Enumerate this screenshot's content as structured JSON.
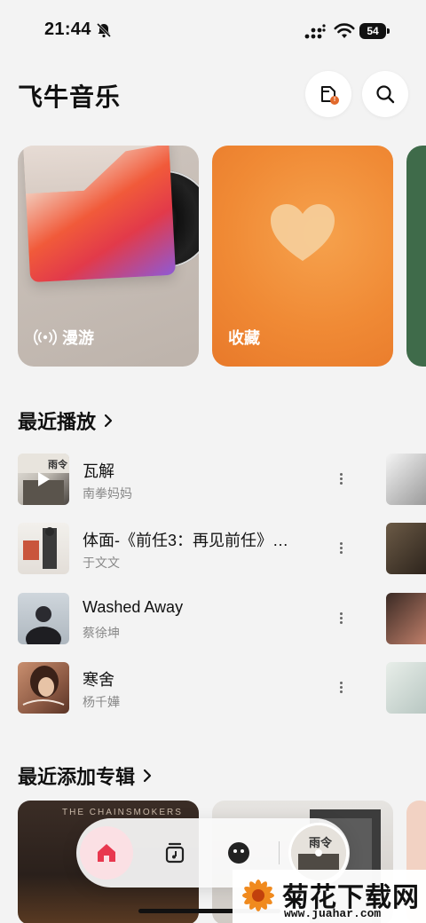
{
  "status_bar": {
    "time": "21:44",
    "battery": "54"
  },
  "header": {
    "title": "飞牛音乐",
    "message_badge": "!"
  },
  "cards": [
    {
      "label": "漫游",
      "icon": "radio-waves-icon"
    },
    {
      "label": "收藏",
      "icon": "heart-icon"
    }
  ],
  "recent": {
    "title": "最近播放",
    "songs": [
      {
        "title": "瓦解",
        "artist": "南拳妈妈",
        "playing": true
      },
      {
        "title": "体面-《前任3：再见前任》…",
        "artist": "于文文"
      },
      {
        "title": "Washed Away",
        "artist": "蔡徐坤"
      },
      {
        "title": "寒舍",
        "artist": "杨千嬅"
      }
    ]
  },
  "albums": {
    "title": "最近添加专辑",
    "items": [
      {
        "caption": "THE CHAINSMOKERS"
      },
      {
        "caption": ""
      }
    ]
  },
  "nav": {
    "items": [
      "home-icon",
      "library-icon",
      "profile-icon"
    ],
    "active": "home-icon"
  },
  "watermark": {
    "title": "菊花下载网",
    "url": "www.juahar.com"
  },
  "colors": {
    "accent": "#e8384f",
    "favorite_card": "#f08a35",
    "roam_card": "#c4bab2",
    "background": "#f3f3f3"
  }
}
